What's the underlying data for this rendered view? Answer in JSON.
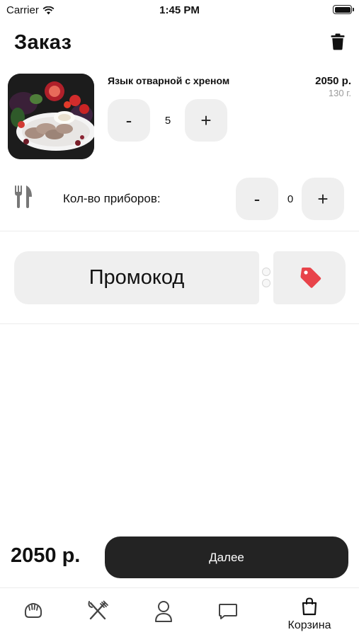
{
  "status_bar": {
    "carrier": "Carrier",
    "time": "1:45 PM"
  },
  "header": {
    "title": "Заказ",
    "delete_icon": "trash-icon"
  },
  "cart_item": {
    "name": "Язык отварной с хреном",
    "price": "2050 р.",
    "weight": "130 г.",
    "quantity": "5",
    "decrement_label": "-",
    "increment_label": "+"
  },
  "cutlery": {
    "icon": "fork-knife-icon",
    "label": "Кол-во приборов:",
    "count": "0",
    "decrement_label": "-",
    "increment_label": "+"
  },
  "promo": {
    "label": "Промокод",
    "icon": "tag-icon",
    "icon_color": "#e8434a"
  },
  "footer": {
    "total": "2050 р.",
    "next_label": "Далее"
  },
  "tab_bar": {
    "tabs": [
      {
        "icon": "dumpling-icon",
        "label": ""
      },
      {
        "icon": "fork-knife-cross-icon",
        "label": ""
      },
      {
        "icon": "profile-icon",
        "label": ""
      },
      {
        "icon": "chat-icon",
        "label": ""
      },
      {
        "icon": "shopping-bag-icon",
        "label": "Корзина",
        "active": true
      }
    ]
  },
  "colors": {
    "button_bg": "#efefef",
    "primary_dark": "#232323",
    "muted_text": "#9a9a9a",
    "accent_red": "#e8434a"
  }
}
